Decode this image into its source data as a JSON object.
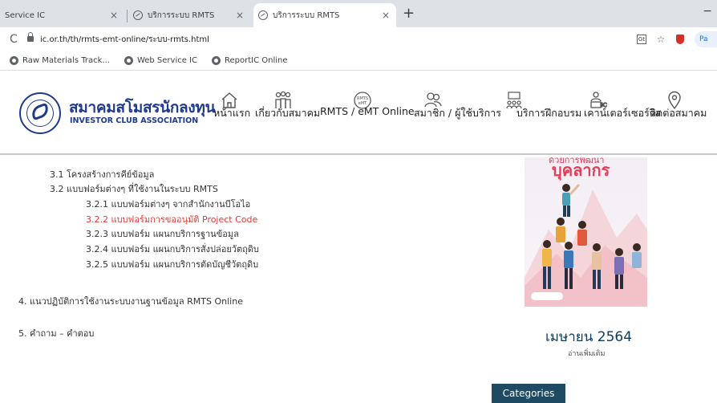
{
  "browser": {
    "tabs": [
      {
        "title": "Service IC",
        "close": "×"
      },
      {
        "title": "บริการระบบ RMTS",
        "close": "×"
      },
      {
        "title": "บริการระบบ RMTS",
        "close": "×"
      }
    ],
    "new_tab": "+",
    "minimize": "−",
    "reload": "C",
    "url": "ic.or.th/th/rmts-emt-online/ระบบ-rmts.html",
    "translate_glyph": "Gt",
    "star": "☆",
    "profile_initials": "Pa",
    "bookmarks": [
      {
        "label": "Raw Materials Track..."
      },
      {
        "label": "Web Service IC"
      },
      {
        "label": "ReportIC Online"
      }
    ]
  },
  "header": {
    "logo_title": "สมาคมสโมสรนักลงทุน",
    "logo_subtitle": "INVESTOR CLUB ASSOCIATION",
    "nav": [
      {
        "label": "หน้าแรก",
        "icon": "home-icon"
      },
      {
        "label": "เกี่ยวกับสมาคม",
        "icon": "people-group-icon"
      },
      {
        "label": "RMTS / eMT Online",
        "icon": "rmts-badge-icon",
        "badge_text": "RMTS eMT"
      },
      {
        "label": "สมาชิก / ผู้ใช้บริการ",
        "icon": "members-icon"
      },
      {
        "label": "บริการฝึกอบรม",
        "icon": "training-icon"
      },
      {
        "label": "เคาน์เตอร์เซอร์วิส",
        "icon": "counter-service-icon"
      },
      {
        "label": "ติดต่อสมาคม",
        "icon": "location-pin-icon"
      }
    ],
    "nav_separator": "/"
  },
  "content": {
    "items": [
      {
        "text": "3.1   โครงสร้างการคีย์ข้อมูล"
      },
      {
        "text": "3.2   แบบฟอร์มต่างๆ ที่ใช้งานในระบบ RMTS"
      },
      {
        "text": "3.2.1 แบบฟอร์มต่างๆ จากสำนักงานบีโอไอ"
      },
      {
        "text": "3.2.2 แบบฟอร์มการขออนุมัติ Project Code"
      },
      {
        "text": "3.2.3 แบบฟอร์ม แผนกบริการฐานข้อมูล"
      },
      {
        "text": "3.2.4 แบบฟอร์ม แผนกบริการสั่งปล่อยวัตถุดิบ"
      },
      {
        "text": "3.2.5 แบบฟอร์ม แผนกบริการตัดบัญชีวัตถุดิบ"
      },
      {
        "text": "4. แนวปฏิบัติการใช้งานระบบงานฐานข้อมูล RMTS Online"
      },
      {
        "text": "5.  คำถาม – คำตอบ"
      }
    ]
  },
  "sidebar": {
    "banner_sub": "ด้วยการพัฒนา",
    "banner_title": "บุคลากร",
    "month": "เมษายน 2564",
    "read_more": "อ่านเพิ่มเติม",
    "categories": "Categories"
  },
  "colors": {
    "brand_navy": "#1f3a8a",
    "link_red": "#e53935",
    "category_badge": "#1f4a63"
  }
}
